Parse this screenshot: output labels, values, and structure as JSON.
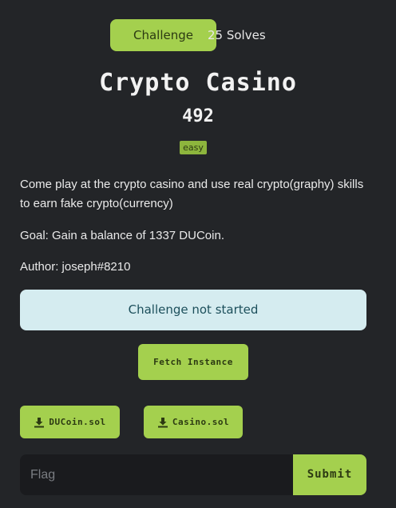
{
  "tabs": {
    "challenge_label": "Challenge",
    "solves_label": "25 Solves"
  },
  "challenge": {
    "title": "Crypto Casino",
    "points": "492",
    "difficulty": "easy",
    "description": [
      "Come play at the crypto casino and use real crypto(graphy) skills to earn fake crypto(currency)",
      "Goal: Gain a balance of 1337 DUCoin.",
      "Author: joseph#8210"
    ],
    "status": "Challenge not started"
  },
  "actions": {
    "fetch_label": "Fetch Instance",
    "files": [
      {
        "name": "DUCoin.sol",
        "icon": "download-icon"
      },
      {
        "name": "Casino.sol",
        "icon": "download-icon"
      }
    ]
  },
  "flag": {
    "placeholder": "Flag",
    "value": "",
    "submit_label": "Submit"
  },
  "colors": {
    "background": "#232528",
    "accent": "#a4d04e",
    "status_bg": "#d5ecf0",
    "status_text": "#1c4f5b"
  }
}
